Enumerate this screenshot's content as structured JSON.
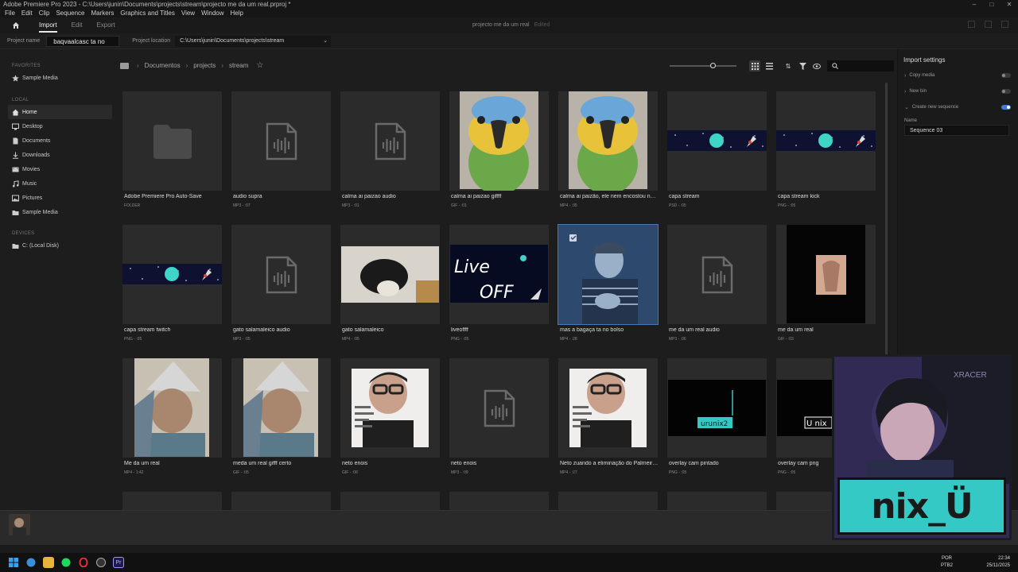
{
  "titlebar": {
    "title": "Adobe Premiere Pro 2023 - C:\\Users\\junin\\Documents\\projects\\stream\\projecto me da um real.prproj *"
  },
  "menu": [
    "File",
    "Edit",
    "Clip",
    "Sequence",
    "Markers",
    "Graphics and Titles",
    "View",
    "Window",
    "Help"
  ],
  "header": {
    "tabs": [
      "Import",
      "Edit",
      "Export"
    ],
    "active_tab": "Import",
    "project_title": "projecto me da um real",
    "edited": "Edited"
  },
  "projectbar": {
    "name_label": "Project name",
    "name_value": "baqvaalcasc ta no cvmdu",
    "location_label": "Project location",
    "location_value": "C:\\Users\\junin\\Documents\\projects\\stream"
  },
  "sidebar": {
    "favorites_label": "FAVORITES",
    "favorites": [
      {
        "label": "Sample Media",
        "icon": "star-icon"
      }
    ],
    "local_label": "LOCAL",
    "local": [
      {
        "label": "Home",
        "icon": "home-icon",
        "selected": true
      },
      {
        "label": "Desktop",
        "icon": "monitor-icon"
      },
      {
        "label": "Documents",
        "icon": "document-icon"
      },
      {
        "label": "Downloads",
        "icon": "download-icon"
      },
      {
        "label": "Movies",
        "icon": "film-icon"
      },
      {
        "label": "Music",
        "icon": "music-icon"
      },
      {
        "label": "Pictures",
        "icon": "image-icon"
      },
      {
        "label": "Sample Media",
        "icon": "folder-icon"
      }
    ],
    "devices_label": "DEVICES",
    "devices": [
      {
        "label": "C: (Local Disk)",
        "icon": "drive-icon"
      }
    ]
  },
  "breadcrumb": [
    "Documentos",
    "projects",
    "stream"
  ],
  "browser": {
    "zoom_level": 0.65,
    "view_mode": "grid"
  },
  "files": [
    {
      "name": "Adobe Premiere Pro Auto-Save",
      "meta": "FOLDER",
      "thumb": "folder"
    },
    {
      "name": "audio supra",
      "meta": "MP3 - :07",
      "thumb": "audio"
    },
    {
      "name": "calma ai paizao audio",
      "meta": "MP3 - :01",
      "thumb": "audio"
    },
    {
      "name": "calma ai paizao giffff",
      "meta": "GIF - :01",
      "thumb": "parrot"
    },
    {
      "name": "calma ai paizão, ele nem encostou nela...",
      "meta": "MP4 - :35",
      "thumb": "parrot"
    },
    {
      "name": "capa stream",
      "meta": "PSD - :05",
      "thumb": "space"
    },
    {
      "name": "capa stream kick",
      "meta": "PNG - :05",
      "thumb": "space"
    },
    {
      "name": "capa stream twitch",
      "meta": "PNG - :05",
      "thumb": "space"
    },
    {
      "name": "gato salamaleico audio",
      "meta": "MP3 - :05",
      "thumb": "audio"
    },
    {
      "name": "gato salamaleico",
      "meta": "MP4 - :05",
      "thumb": "cat"
    },
    {
      "name": "liveoffff",
      "meta": "PNG - :05",
      "thumb": "liveoff"
    },
    {
      "name": "mas a bagaça ta no bolso",
      "meta": "MP4 - :28",
      "thumb": "man",
      "selected": true
    },
    {
      "name": "me da um real audio",
      "meta": "MP3 - :06",
      "thumb": "audio"
    },
    {
      "name": "me da um real",
      "meta": "GIF - :03",
      "thumb": "hands"
    },
    {
      "name": "Me da um real",
      "meta": "MP4 - 1:42",
      "thumb": "foil"
    },
    {
      "name": "meda um real gifff certo",
      "meta": "GIF - :05",
      "thumb": "foil"
    },
    {
      "name": "neto enois",
      "meta": "GIF - :08",
      "thumb": "neto"
    },
    {
      "name": "neto enois",
      "meta": "MP3 - :09",
      "thumb": "audio"
    },
    {
      "name": "Neto zuando a eliminação do Palmeira...",
      "meta": "MP4 - :27",
      "thumb": "neto"
    },
    {
      "name": "overlay cam pintado",
      "meta": "PNG - :05",
      "thumb": "overlay"
    },
    {
      "name": "overlay cam png",
      "meta": "PNG - :05",
      "thumb": "overlay2"
    }
  ],
  "overlay_text": {
    "overlay_cam_pintado": "urunix2",
    "overlay_cam_png": "U nix"
  },
  "liveoff_text": {
    "line1": "Live",
    "line2": "OFF"
  },
  "import_settings": {
    "title": "Import settings",
    "copy_media": {
      "label": "Copy media",
      "on": false
    },
    "new_bin": {
      "label": "New bin",
      "on": false
    },
    "create_sequence": {
      "label": "Create new sequence",
      "on": true
    },
    "name_label": "Name",
    "sequence_name": "Sequence 03"
  },
  "taskbar": {
    "lang": "POR",
    "lang2": "PTB2",
    "time": "22:34",
    "date": "25/11/2025"
  },
  "webcam": {
    "label": "nix_Ü",
    "chair_brand": "XRACER"
  },
  "colors": {
    "accent": "#3f79d9",
    "selection": "#2d4a6e",
    "cam_label_bg": "#35c9c5"
  }
}
